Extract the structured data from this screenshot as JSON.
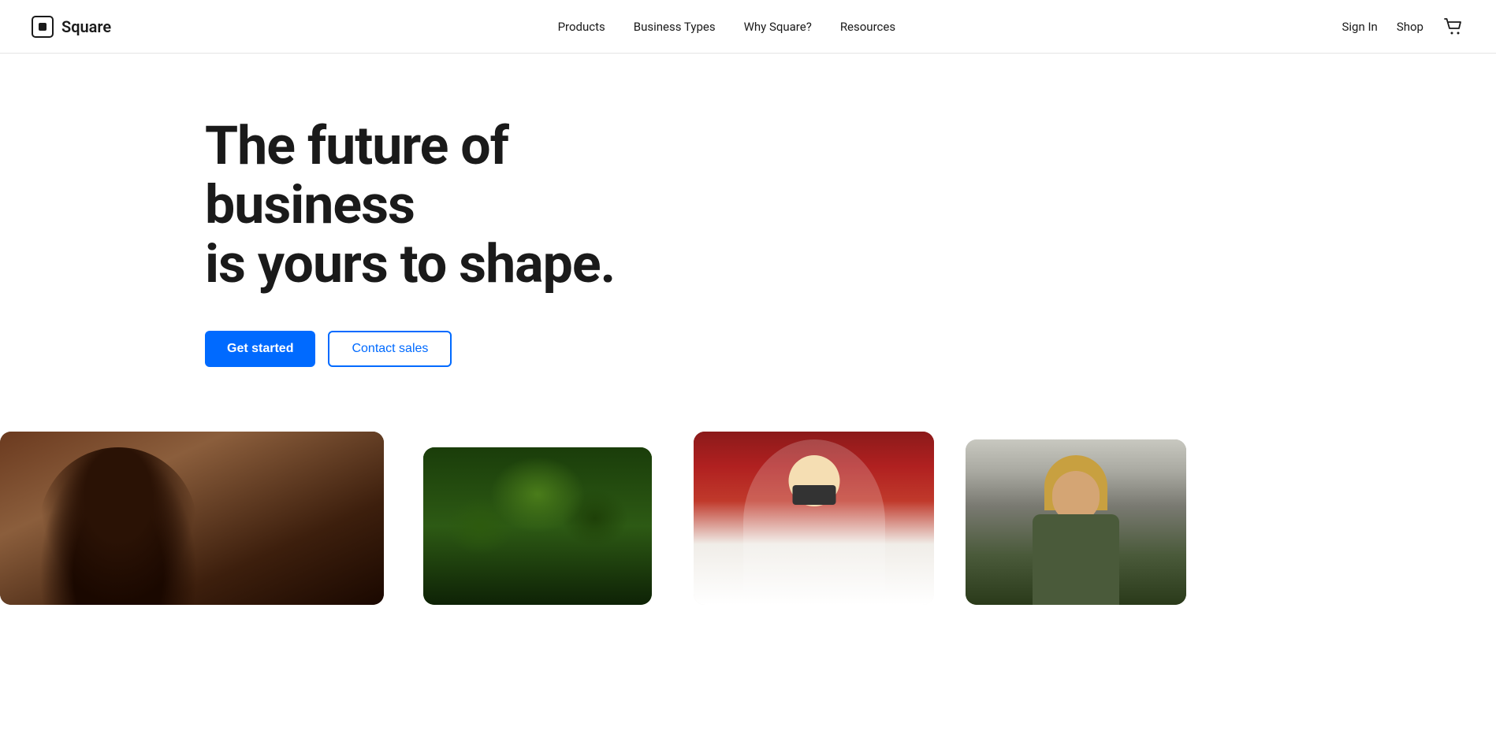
{
  "brand": {
    "name": "Square",
    "logo_aria": "Square logo"
  },
  "navbar": {
    "links": [
      {
        "id": "products",
        "label": "Products"
      },
      {
        "id": "business-types",
        "label": "Business Types"
      },
      {
        "id": "why-square",
        "label": "Why Square?"
      },
      {
        "id": "resources",
        "label": "Resources"
      }
    ],
    "sign_in_label": "Sign In",
    "shop_label": "Shop",
    "cart_aria": "Shopping cart"
  },
  "hero": {
    "headline_line1": "The future of business",
    "headline_line2": "is yours to shape.",
    "cta_primary": "Get started",
    "cta_secondary": "Contact sales"
  },
  "colors": {
    "accent_blue": "#006aff",
    "text_dark": "#1a1a1a",
    "border_light": "#e5e5e5"
  }
}
